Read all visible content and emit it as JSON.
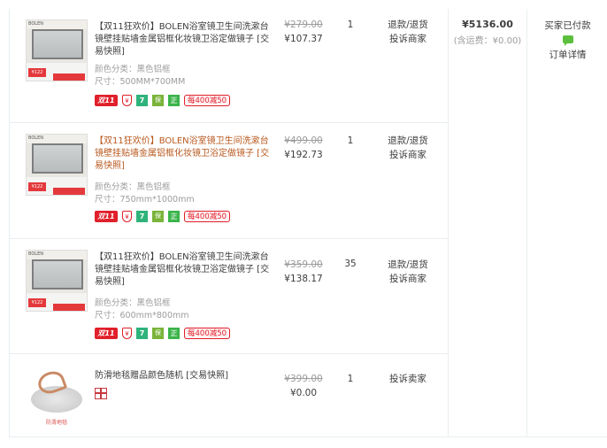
{
  "items": [
    {
      "thumb_brand": "BOLEN",
      "thumb_tag": "¥122",
      "title": "【双11狂欢价】BOLEN浴室镜卫生间洗漱台镜壁挂贴墙金属铝框化妆镜卫浴定做镜子 [交易快照]",
      "color": "颜色分类：黑色铝框",
      "size": "尺寸：500MM*700MM",
      "orig_price": "¥279.00",
      "price": "¥107.37",
      "qty": "1",
      "ops": [
        "退款/退货",
        "投诉商家"
      ]
    },
    {
      "thumb_brand": "BOLEN",
      "thumb_tag": "¥122",
      "title": "【双11狂欢价】BOLEN浴室镜卫生间洗漱台镜壁挂贴墙金属铝框化妆镜卫浴定做镜子 [交易快照]",
      "color": "颜色分类：黑色铝框",
      "size": "尺寸：750mm*1000mm",
      "orig_price": "¥499.00",
      "price": "¥192.73",
      "qty": "1",
      "ops": [
        "退款/退货",
        "投诉商家"
      ]
    },
    {
      "thumb_brand": "BOLEN",
      "thumb_tag": "¥122",
      "title": "【双11狂欢价】BOLEN浴室镜卫生间洗漱台镜壁挂贴墙金属铝框化妆镜卫浴定做镜子 [交易快照]",
      "color": "颜色分类：黑色铝框",
      "size": "尺寸：600mm*800mm",
      "orig_price": "¥359.00",
      "price": "¥138.17",
      "qty": "35",
      "ops": [
        "退款/退货",
        "投诉商家"
      ]
    },
    {
      "thumb_caption": "防滑地毯",
      "title": "防滑地毯赠品颜色随机 [交易快照]",
      "orig_price": "¥399.00",
      "price": "¥0.00",
      "qty": "1",
      "ops": [
        "投诉卖家"
      ]
    }
  ],
  "badges": {
    "double11": "双11",
    "shield": "¥",
    "seven": "7",
    "guard": "保",
    "zheng": "正",
    "promo": "每400减50"
  },
  "order": {
    "total": "¥5136.00",
    "shipping": "(含运费：¥0.00)",
    "status": "买家已付款",
    "detail_link": "订单详情"
  },
  "colors": {
    "promo_red": "#e0202b",
    "link_orange": "#b8581e",
    "chat_green": "#5cbf3c"
  }
}
